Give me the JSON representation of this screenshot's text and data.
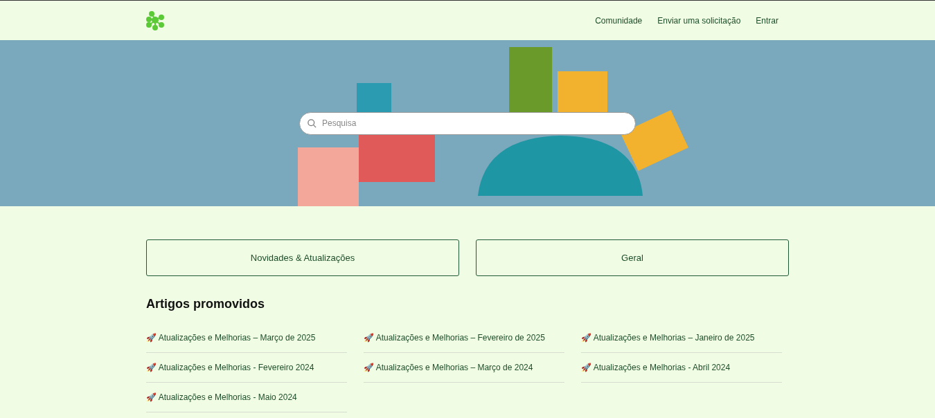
{
  "header": {
    "nav": [
      "Comunidade",
      "Enviar uma solicitação",
      "Entrar"
    ]
  },
  "hero": {
    "search": {
      "placeholder": "Pesquisa"
    }
  },
  "categories": [
    "Novidades & Atualizações",
    "Geral"
  ],
  "promoted": {
    "title": "Artigos promovidos",
    "articles": [
      "🚀 Atualizações e Melhorias – Março de 2025",
      "🚀 Atualizações e Melhorias – Fevereiro de 2025",
      "🚀 Atualizações e Melhorias – Janeiro de 2025",
      "🚀 Atualizações e Melhorias - Fevereiro 2024",
      "🚀 Atualizações e Melhorias – Março de 2024",
      "🚀 Atualizações e Melhorias - Abril 2024",
      "🚀 Atualizações e Melhorias - Maio 2024"
    ]
  }
}
